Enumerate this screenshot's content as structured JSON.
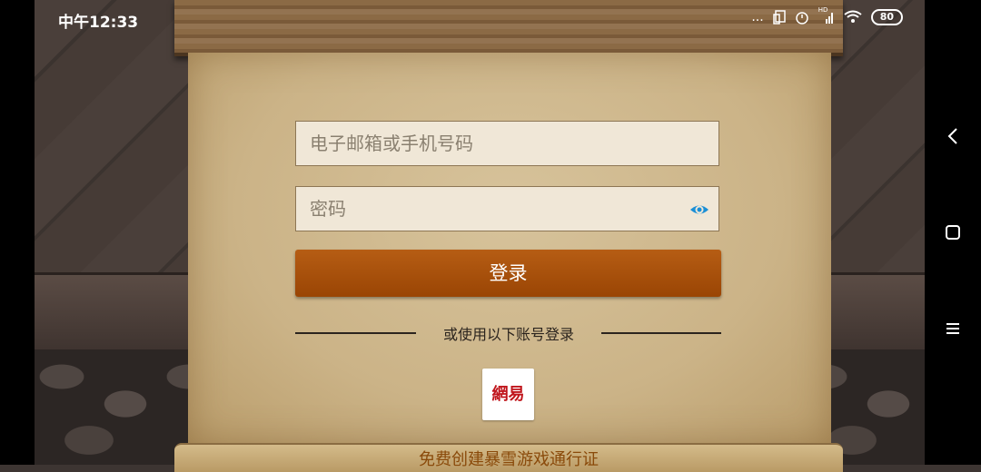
{
  "status_bar": {
    "time": "中午12:33",
    "dots": "...",
    "network_label": "HD",
    "battery": "80"
  },
  "login_form": {
    "account_placeholder": "电子邮箱或手机号码",
    "password_placeholder": "密码",
    "login_label": "登录",
    "alt_login_text": "或使用以下账号登录",
    "netease_label": "網易",
    "create_account_link": "免费创建暴雪游戏通行证"
  },
  "icons": {
    "eye": "eye-icon",
    "back": "back-icon",
    "home": "home-icon",
    "menu": "menu-icon"
  },
  "colors": {
    "accent": "#a44f09",
    "link": "#8a4a0a",
    "eye": "#1a8fd6",
    "netease_red": "#c0161c"
  }
}
